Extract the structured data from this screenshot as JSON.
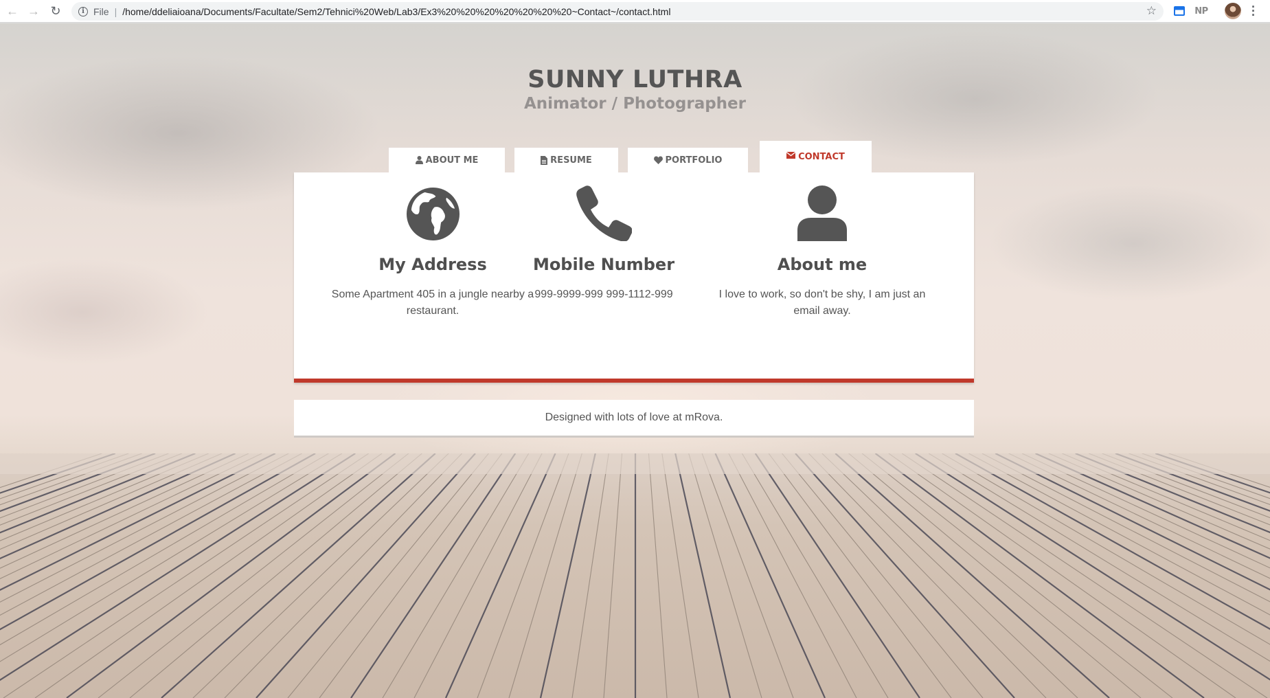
{
  "browser": {
    "scheme": "File",
    "url": "/home/ddeliaioana/Documents/Facultate/Sem2/Tehnici%20Web/Lab3/Ex3%20%20%20%20%20%20%20~Contact~/contact.html",
    "extension_label": "NP"
  },
  "header": {
    "name": "SUNNY LUTHRA",
    "role": "Animator / Photographer"
  },
  "tabs": [
    {
      "label": "ABOUT ME",
      "icon": "user-icon",
      "active": false
    },
    {
      "label": "RESUME",
      "icon": "file-icon",
      "active": false
    },
    {
      "label": "PORTFOLIO",
      "icon": "heart-icon",
      "active": false
    },
    {
      "label": "CONTACT",
      "icon": "envelope-icon",
      "active": true
    }
  ],
  "contact": [
    {
      "icon": "globe-icon",
      "title": "My Address",
      "text": "Some Apartment 405 in a jungle nearby a restaurant."
    },
    {
      "icon": "phone-icon",
      "title": "Mobile Number",
      "text": "999-9999-999 999-1112-999"
    },
    {
      "icon": "person-icon",
      "title": "About me",
      "text": "I love to work, so don't be shy, I am just an email away."
    }
  ],
  "footer": {
    "text": "Designed with lots of love at mRova."
  },
  "colors": {
    "accent": "#c0392b",
    "text": "#555555",
    "icon": "#555555"
  }
}
